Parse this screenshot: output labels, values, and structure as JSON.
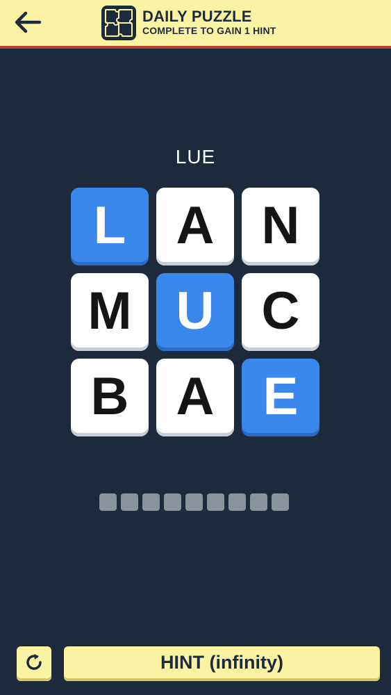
{
  "header": {
    "title": "DAILY PUZZLE",
    "subtitle": "COMPLETE TO GAIN 1 HINT",
    "back_icon": "arrow-left-icon",
    "puzzle_icon": "puzzle-pieces-icon"
  },
  "clue": "LUE",
  "grid": {
    "tiles": [
      {
        "letter": "L",
        "selected": true
      },
      {
        "letter": "A",
        "selected": false
      },
      {
        "letter": "N",
        "selected": false
      },
      {
        "letter": "M",
        "selected": false
      },
      {
        "letter": "U",
        "selected": true
      },
      {
        "letter": "C",
        "selected": false
      },
      {
        "letter": "B",
        "selected": false
      },
      {
        "letter": "A",
        "selected": false
      },
      {
        "letter": "E",
        "selected": true
      }
    ]
  },
  "answer_slots": 9,
  "footer": {
    "reset_icon": "refresh-icon",
    "hint_label": "HINT (infinity)"
  },
  "colors": {
    "background": "#1d2a3b",
    "header": "#fbf3a4",
    "header_border": "#b3452f",
    "selected_tile": "#3b88ec",
    "tile": "#ffffff",
    "slot": "#8a929b"
  }
}
